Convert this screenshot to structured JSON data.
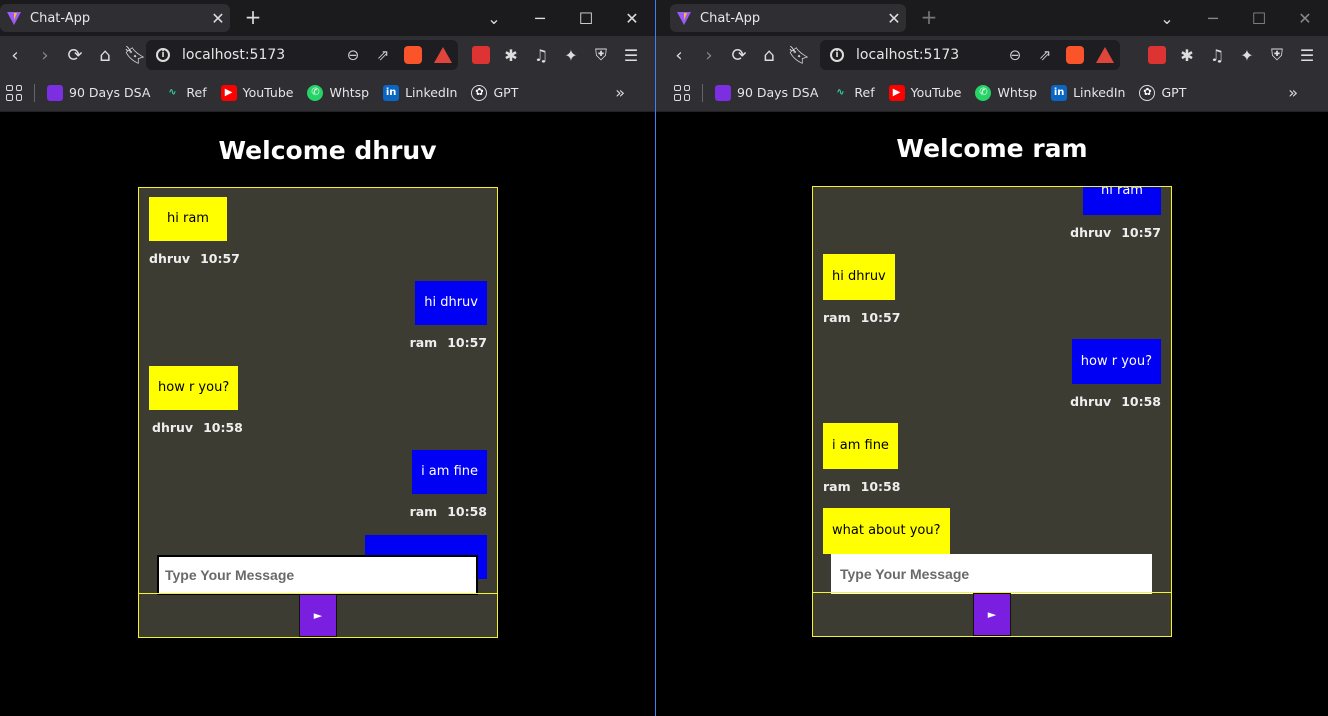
{
  "windows": [
    {
      "tab_title": "Chat-App",
      "url": "localhost:5173",
      "bookmarks": [
        "90 Days DSA",
        "Ref",
        "YouTube",
        "Whtsp",
        "LinkedIn",
        "GPT"
      ],
      "welcome": "Welcome dhruv",
      "messages": [
        {
          "text": "hi ram",
          "user": "dhruv",
          "time": "10:57"
        },
        {
          "text": "hi dhruv",
          "user": "ram",
          "time": "10:57"
        },
        {
          "text": "how r you?",
          "user": "dhruv",
          "time": "10:58"
        },
        {
          "text": "i am fine",
          "user": "ram",
          "time": "10:58"
        }
      ],
      "input_placeholder": "Type Your Message",
      "send_label": "►"
    },
    {
      "tab_title": "Chat-App",
      "url": "localhost:5173",
      "bookmarks": [
        "90 Days DSA",
        "Ref",
        "YouTube",
        "Whtsp",
        "LinkedIn",
        "GPT"
      ],
      "welcome": "Welcome ram",
      "messages": [
        {
          "text": "hi ram",
          "user": "dhruv",
          "time": "10:57"
        },
        {
          "text": "hi dhruv",
          "user": "ram",
          "time": "10:57"
        },
        {
          "text": "how r you?",
          "user": "dhruv",
          "time": "10:58"
        },
        {
          "text": "i am fine",
          "user": "ram",
          "time": "10:58"
        },
        {
          "text": "what about you?",
          "user": "",
          "time": ""
        }
      ],
      "input_placeholder": "Type Your Message",
      "send_label": "►"
    }
  ],
  "colors": {
    "own_bubble": "#0000f5",
    "other_bubble": "#ffff00",
    "chat_border": "#f5f232",
    "send_button": "#7a1ee0"
  }
}
